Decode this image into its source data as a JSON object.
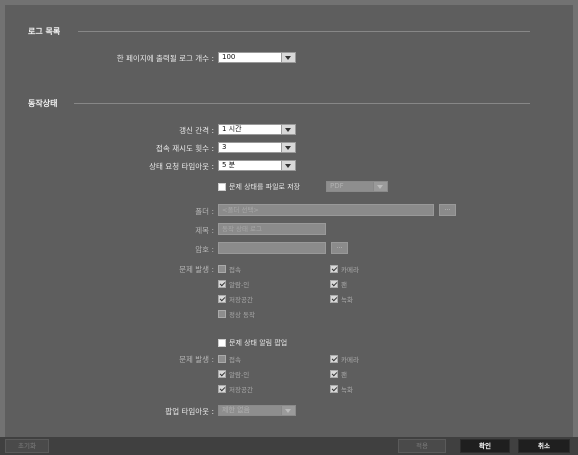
{
  "sections": {
    "log_list": "로그 목록",
    "status": "동작상태"
  },
  "log_list": {
    "per_page_label": "한 페이지에 출력될 로그 개수 :",
    "per_page_value": "100"
  },
  "status": {
    "refresh_label": "갱신 간격 :",
    "refresh_value": "1 시간",
    "retry_label": "접속 재시도 횟수 :",
    "retry_value": "3",
    "timeout_label": "상태 요청 타임아웃 :",
    "timeout_value": "5 분",
    "save_label": "문제 상태를 파일로 저장",
    "save_format": "PDF",
    "folder_label": "폴더 :",
    "folder_placeholder": "<폴더 선택>",
    "folder_btn": "...",
    "title_label": "제목 :",
    "title_value": "동작 상태 로그",
    "password_label": "암호 :",
    "password_btn": "...",
    "problem_label": "문제 발생 :",
    "problems": {
      "connect": "접속",
      "camera": "카메라",
      "alarm_in": "알람-인",
      "fan": "팬",
      "storage": "저장공간",
      "record": "녹화",
      "abnormal": "정상 동작"
    },
    "popup_label": "문제 상태 알림 팝업",
    "popup_problem_label": "문제 발생 :",
    "popup_problems": {
      "connect": "접속",
      "camera": "카메라",
      "alarm_in": "알람-인",
      "fan": "팬",
      "storage": "저장공간",
      "record": "녹화"
    },
    "popup_timeout_label": "팝업 타임아웃 :",
    "popup_timeout_value": "제한 없음"
  },
  "footer": {
    "reset": "초기화",
    "apply": "적용",
    "ok": "확인",
    "cancel": "취소"
  }
}
